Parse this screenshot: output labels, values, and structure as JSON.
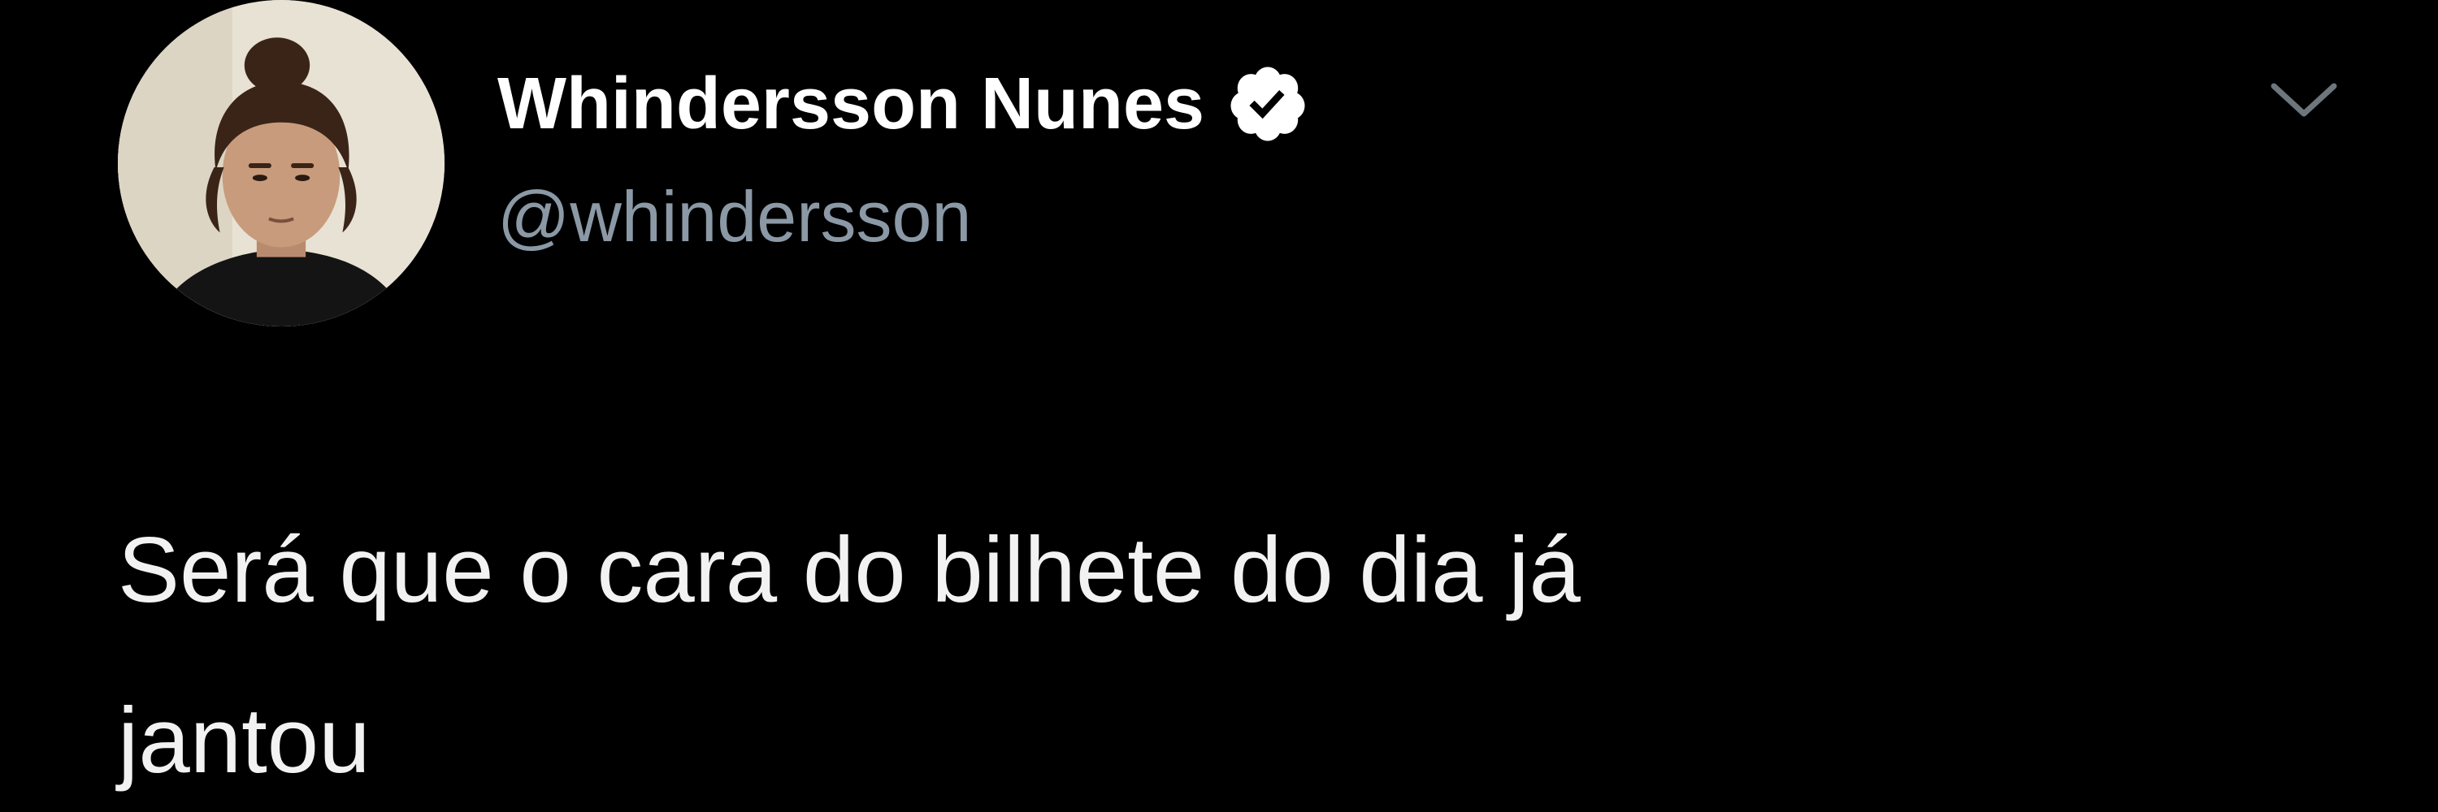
{
  "author": {
    "display_name": "Whindersson Nunes",
    "handle": "@whindersson",
    "verified": true
  },
  "tweet": {
    "text_lines": [
      "Será que o cara do bilhete do dia já",
      "jantou"
    ]
  },
  "icons": {
    "verified": "verified-badge-icon",
    "menu": "chevron-down-icon"
  },
  "colors": {
    "background": "#000000",
    "name": "#ffffff",
    "handle": "#8b98a5",
    "text": "#f2f2f2"
  }
}
